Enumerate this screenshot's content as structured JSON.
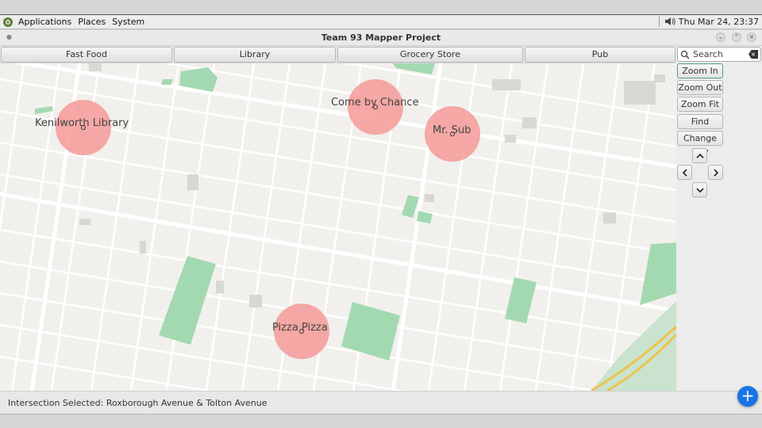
{
  "topbar": {
    "menus": [
      "Applications",
      "Places",
      "System"
    ],
    "clock": "Thu Mar 24, 23:37",
    "volume_icon": "speaker-icon"
  },
  "window": {
    "title": "Team 93 Mapper Project"
  },
  "categories": [
    "Fast Food",
    "Library",
    "Grocery Store",
    "Pub"
  ],
  "search": {
    "placeholder": "Search"
  },
  "side_buttons": {
    "zoom_in": "Zoom In",
    "zoom_out": "Zoom Out",
    "zoom_fit": "Zoom Fit",
    "find": "Find",
    "change_city": "Change City"
  },
  "arrows": {
    "up": "⌃",
    "left": "‹",
    "right": "›",
    "down": "⌄"
  },
  "pois": [
    {
      "name": "Kenilworth Library"
    },
    {
      "name": "Come by Chance"
    },
    {
      "name": "Mr. Sub"
    },
    {
      "name": "Pizza Pizza"
    }
  ],
  "status": {
    "text": "Intersection Selected: Roxborough Avenue & Tolton Avenue"
  },
  "fab": {
    "label": "+"
  },
  "colors": {
    "park": "#a3d9b1",
    "poi_highlight": "#f49a96",
    "highway": "#f0c24a",
    "water": "#c7dff0",
    "accent": "#1a73e8"
  }
}
